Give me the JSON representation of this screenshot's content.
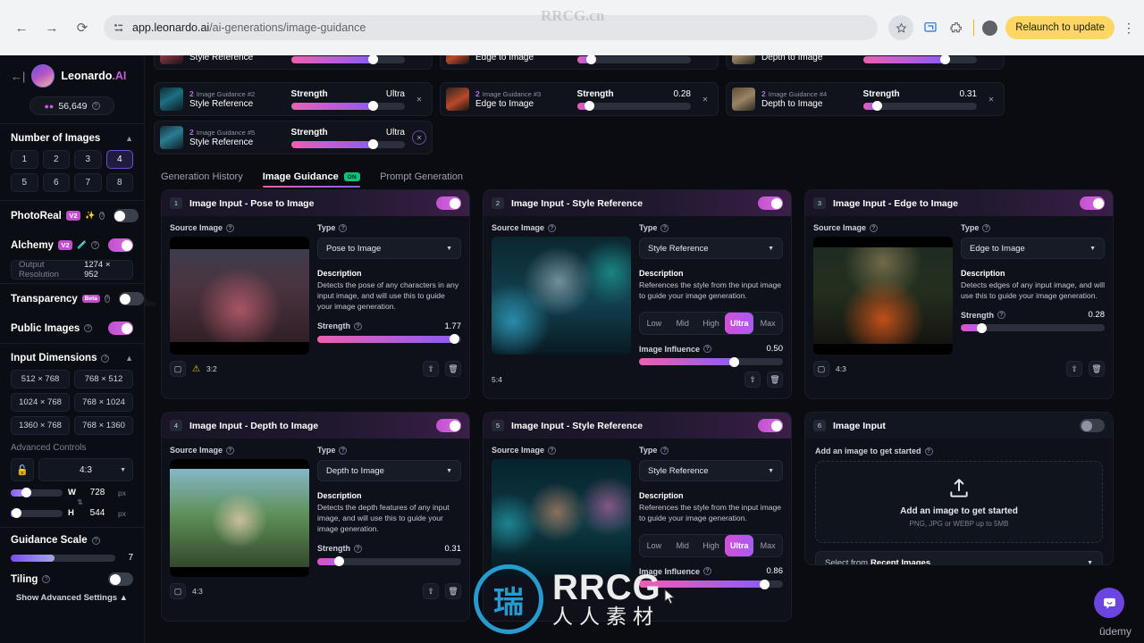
{
  "browser": {
    "back_icon": "back-arrow-icon",
    "forward_icon": "forward-arrow-icon",
    "reload_icon": "reload-icon",
    "url_host": "app.leonardo.ai",
    "url_path": "/ai-generations/image-guidance",
    "star_icon": "bookmark-star-icon",
    "cast_icon": "cast-icon",
    "extensions_icon": "puzzle-extension-icon",
    "relaunch_label": "Relaunch to update",
    "menu_icon": "kebab-menu-icon"
  },
  "sidebar": {
    "collapse_icon": "collapse-panel-icon",
    "brand": "Leonardo",
    "brand_suffix": ".AI",
    "credits": "56,649",
    "number_of_images": {
      "title": "Number of Images",
      "options": [
        "1",
        "2",
        "3",
        "4",
        "5",
        "6",
        "7",
        "8"
      ],
      "selected": "4"
    },
    "photoreal": {
      "label": "PhotoReal",
      "badge": "V2",
      "on": false
    },
    "alchemy": {
      "label": "Alchemy",
      "badge": "V2",
      "on": true
    },
    "output_resolution": {
      "label": "Output Resolution",
      "value": "1274 × 952"
    },
    "transparency": {
      "label": "Transparency",
      "badge": "Beta",
      "on": false
    },
    "public_images": {
      "label": "Public Images",
      "on": true
    },
    "input_dimensions": {
      "title": "Input Dimensions",
      "presets": [
        "512 × 768",
        "768 × 512",
        "1024 × 768",
        "768 × 1024",
        "1360 × 768",
        "768 × 1360"
      ]
    },
    "advanced_controls_label": "Advanced Controls",
    "lock_icon": "unlock-icon",
    "aspect_ratio": "4:3",
    "width": {
      "key": "W",
      "value": "728",
      "unit": "px"
    },
    "height": {
      "key": "H",
      "value": "544",
      "unit": "px"
    },
    "swap_icon": "swap-dimensions-icon",
    "guidance_scale": {
      "label": "Guidance Scale",
      "value": "7"
    },
    "tiling": {
      "label": "Tiling",
      "on": false
    },
    "show_advanced": "Show Advanced Settings"
  },
  "guidance_strip": {
    "cards": [
      {
        "id_prefix": "2",
        "id_label": "Image Guidance #2",
        "name": "Style Reference",
        "strength_label": "Strength",
        "strength_value": "Ultra",
        "fill_pct": 72,
        "close_icon": "close-icon"
      },
      {
        "id_prefix": "2",
        "id_label": "Image Guidance #3",
        "name": "Edge to Image",
        "strength_label": "Strength",
        "strength_value": "0.28",
        "fill_pct": 9,
        "close_icon": "close-icon"
      },
      {
        "id_prefix": "2",
        "id_label": "Image Guidance #4",
        "name": "Depth to Image",
        "strength_label": "Strength",
        "strength_value": "0.31",
        "fill_pct": 11,
        "close_icon": "close-icon"
      },
      {
        "id_prefix": "2",
        "id_label": "Image Guidance #5",
        "name": "Style Reference",
        "strength_label": "Strength",
        "strength_value": "Ultra",
        "fill_pct": 72,
        "close_icon": "close-icon"
      }
    ]
  },
  "tabs": [
    {
      "label": "Generation History",
      "active": false
    },
    {
      "label": "Image Guidance",
      "active": true,
      "pill": "ON"
    },
    {
      "label": "Prompt Generation",
      "active": false
    }
  ],
  "labels": {
    "source_image": "Source Image",
    "type": "Type",
    "description": "Description",
    "strength": "Strength",
    "image_influence": "Image Influence",
    "add_image": "Add an image to get started",
    "upload_hint": "PNG, JPG or WEBP up to 5MB",
    "recent_prefix": "Select from",
    "recent_bold": "Recent Images",
    "edit_icon": "crop-edit-icon",
    "upload_icon": "upload-icon",
    "delete_icon": "trash-icon",
    "warning_icon": "warning-icon",
    "chevron_icon": "chevron-down-icon",
    "help_icon": "help-circle-icon"
  },
  "cards": [
    {
      "num": "1",
      "title": "Image Input - Pose to Image",
      "enabled": true,
      "type": "Pose to Image",
      "description": "Detects the pose of any characters in any input image, and will use this to guide your image generation.",
      "control": "strength",
      "strength_label": "Strength",
      "strength_value": "1.77",
      "fill_pct": 96,
      "ratio": "3:2",
      "warning": true
    },
    {
      "num": "2",
      "title": "Image Input - Style Reference",
      "enabled": true,
      "type": "Style Reference",
      "description": "References the style from the input image to guide your image generation.",
      "control": "segmented",
      "segments": [
        "Low",
        "Mid",
        "High",
        "Ultra",
        "Max"
      ],
      "segment_selected": "Ultra",
      "influence_label": "Image Influence",
      "influence_value": "0.50",
      "fill_pct": 67,
      "ratio": "5:4",
      "warning": false
    },
    {
      "num": "3",
      "title": "Image Input - Edge to Image",
      "enabled": true,
      "type": "Edge to Image",
      "description": "Detects edges of any input image, and will use this to guide your image generation.",
      "control": "strength",
      "strength_label": "Strength",
      "strength_value": "0.28",
      "fill_pct": 15,
      "ratio": "4:3",
      "warning": false
    },
    {
      "num": "4",
      "title": "Image Input - Depth to Image",
      "enabled": true,
      "type": "Depth to Image",
      "description": "Detects the depth features of any input image, and will use this to guide your image generation.",
      "control": "strength",
      "strength_label": "Strength",
      "strength_value": "0.31",
      "fill_pct": 16,
      "ratio": "4:3",
      "warning": false
    },
    {
      "num": "5",
      "title": "Image Input - Style Reference",
      "enabled": true,
      "type": "Style Reference",
      "description": "References the style from the input image to guide your image generation.",
      "control": "segmented",
      "segments": [
        "Low",
        "Mid",
        "High",
        "Ultra",
        "Max"
      ],
      "segment_selected": "Ultra",
      "influence_label": "Image Influence",
      "influence_value": "0.86",
      "fill_pct": 88,
      "ratio": "",
      "warning": false
    },
    {
      "num": "6",
      "title": "Image Input",
      "enabled": false,
      "control": "upload"
    }
  ],
  "chat": {
    "icon": "chat-bubble-icon"
  },
  "watermarks": {
    "udemy": "ûdemy",
    "rrcg": "RRCG",
    "rrcg_cn": "人人素材",
    "mono": "R"
  }
}
